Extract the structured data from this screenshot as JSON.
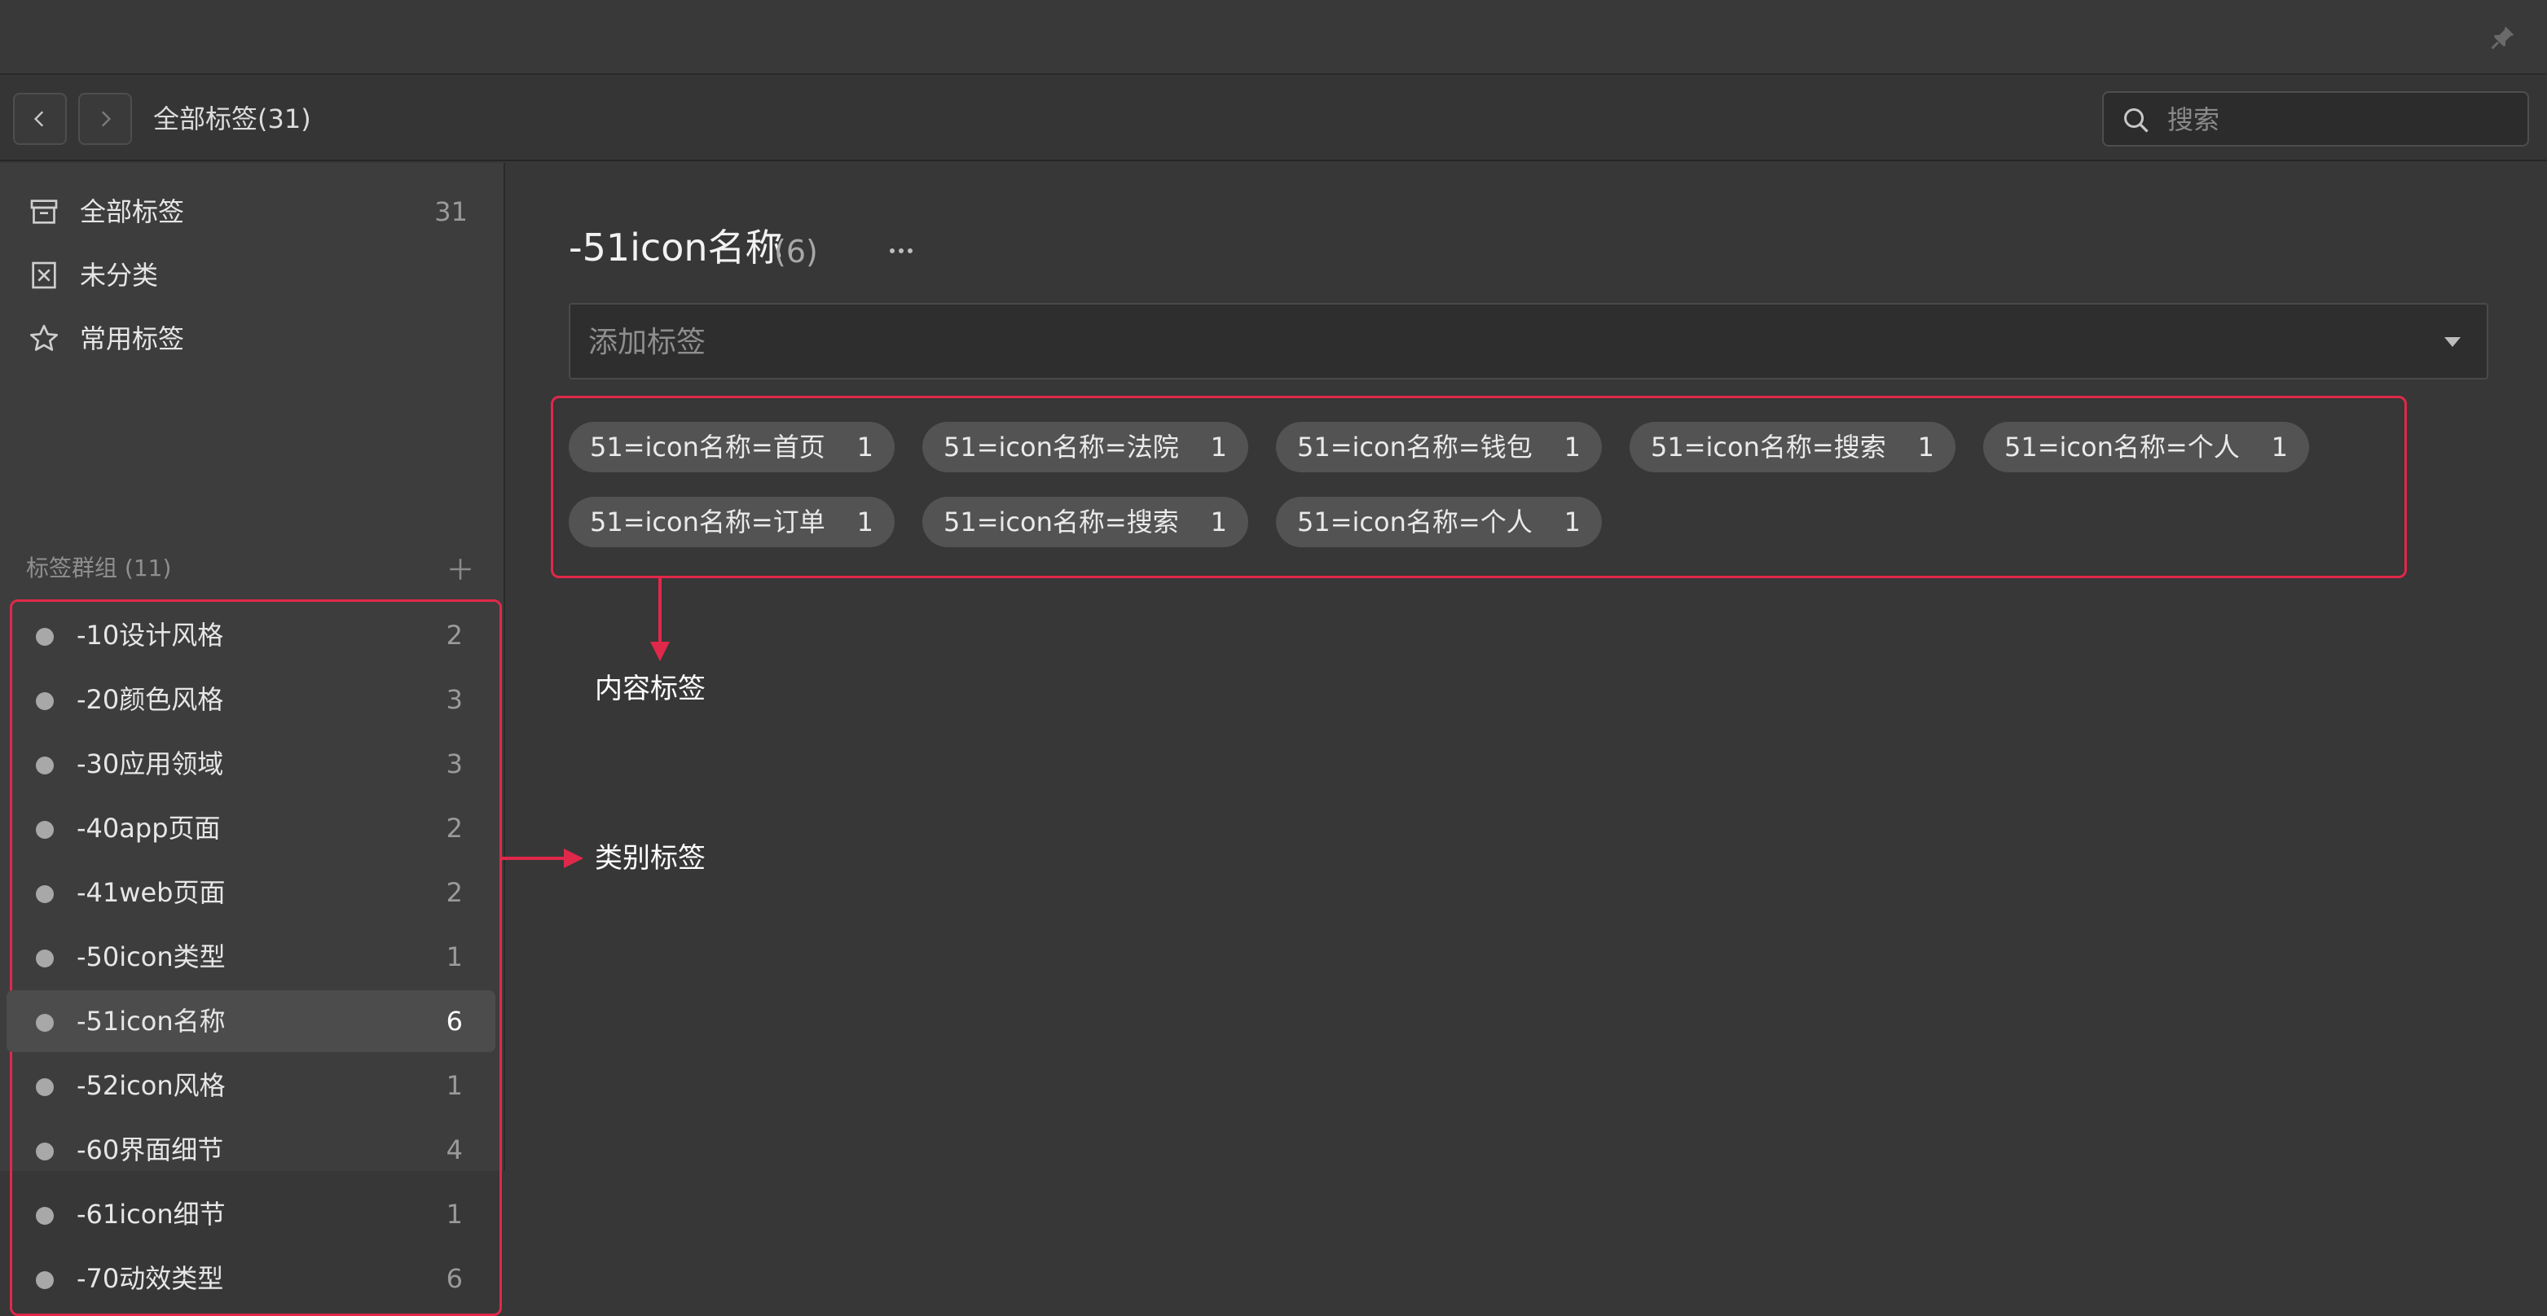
{
  "toolbar": {
    "title": "全部标签(31)",
    "search_placeholder": "搜索"
  },
  "sidebar": {
    "top_items": [
      {
        "label": "全部标签",
        "count": "31",
        "icon": "archive-box-icon"
      },
      {
        "label": "未分类",
        "count": "",
        "icon": "untagged-icon"
      },
      {
        "label": "常用标签",
        "count": "",
        "icon": "star-icon"
      }
    ],
    "group_header": "标签群组 (11)",
    "groups": [
      {
        "label": "-10设计风格",
        "count": "2"
      },
      {
        "label": "-20颜色风格",
        "count": "3"
      },
      {
        "label": "-30应用领域",
        "count": "3"
      },
      {
        "label": "-40app页面",
        "count": "2"
      },
      {
        "label": "-41web页面",
        "count": "2"
      },
      {
        "label": "-50icon类型",
        "count": "1"
      },
      {
        "label": "-51icon名称",
        "count": "6",
        "active": true
      },
      {
        "label": "-52icon风格",
        "count": "1"
      },
      {
        "label": "-60界面细节",
        "count": "4"
      },
      {
        "label": "-61icon细节",
        "count": "1"
      },
      {
        "label": "-70动效类型",
        "count": "6"
      }
    ]
  },
  "main": {
    "heading": "-51icon名称",
    "heading_count": "(6)",
    "add_tag_placeholder": "添加标签",
    "tags": [
      {
        "label": "51=icon名称=首页",
        "count": "1"
      },
      {
        "label": "51=icon名称=法院",
        "count": "1"
      },
      {
        "label": "51=icon名称=钱包",
        "count": "1"
      },
      {
        "label": "51=icon名称=搜索",
        "count": "1"
      },
      {
        "label": "51=icon名称=个人",
        "count": "1"
      },
      {
        "label": "51=icon名称=订单",
        "count": "1"
      },
      {
        "label": "51=icon名称=搜索",
        "count": "1"
      },
      {
        "label": "51=icon名称=个人",
        "count": "1"
      }
    ]
  },
  "annotations": {
    "content_tags": "内容标签",
    "category_tags": "类别标签"
  },
  "colors": {
    "annotation_red": "#e0284a",
    "background": "#373737",
    "sidebar": "#3d3d3d",
    "chip": "#535353"
  }
}
